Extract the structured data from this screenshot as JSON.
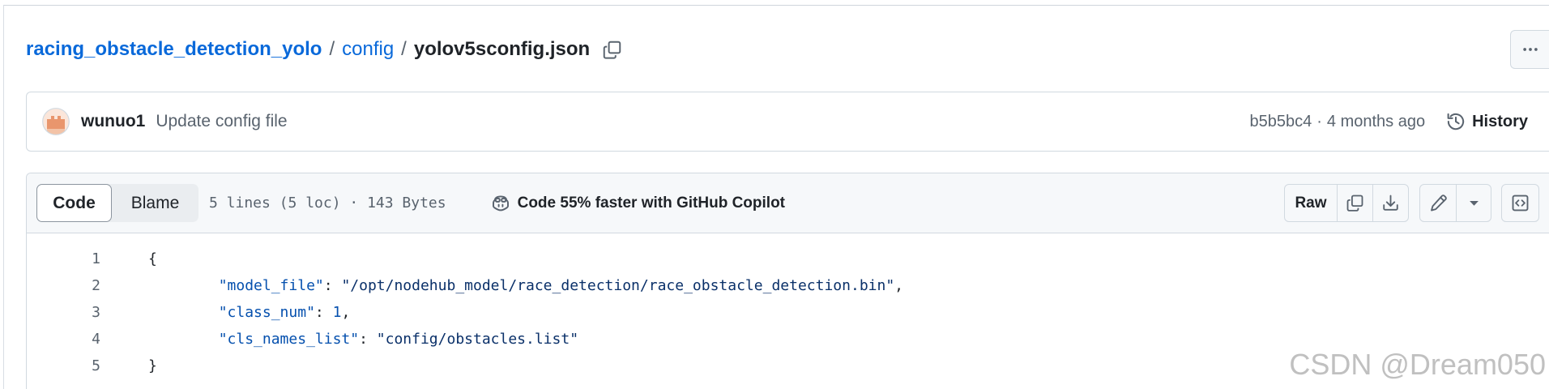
{
  "breadcrumb": {
    "repo": "racing_obstacle_detection_yolo",
    "separator": "/",
    "folder": "config",
    "file": "yolov5sconfig.json"
  },
  "commit": {
    "author": "wunuo1",
    "message": "Update config file",
    "sha": "b5b5bc4",
    "dot": "·",
    "time": "4 months ago",
    "history": "History"
  },
  "file_header": {
    "tabs": [
      {
        "label": "Code",
        "selected": true
      },
      {
        "label": "Blame",
        "selected": false
      }
    ],
    "info": "5 lines (5 loc) · 143 Bytes",
    "copilot": "Code 55% faster with GitHub Copilot",
    "raw": "Raw"
  },
  "code": {
    "lines": [
      {
        "number": "1",
        "tokens": [
          {
            "type": "punct",
            "text": "{"
          }
        ]
      },
      {
        "number": "2",
        "tokens": [
          {
            "type": "plain",
            "text": "\t"
          },
          {
            "type": "key",
            "text": "\"model_file\""
          },
          {
            "type": "punct",
            "text": ": "
          },
          {
            "type": "string",
            "text": "\"/opt/nodehub_model/race_detection/race_obstacle_detection.bin\""
          },
          {
            "type": "punct",
            "text": ","
          }
        ]
      },
      {
        "number": "3",
        "tokens": [
          {
            "type": "plain",
            "text": "\t"
          },
          {
            "type": "key",
            "text": "\"class_num\""
          },
          {
            "type": "punct",
            "text": ": "
          },
          {
            "type": "number",
            "text": "1"
          },
          {
            "type": "punct",
            "text": ","
          }
        ]
      },
      {
        "number": "4",
        "tokens": [
          {
            "type": "plain",
            "text": "\t"
          },
          {
            "type": "key",
            "text": "\"cls_names_list\""
          },
          {
            "type": "punct",
            "text": ": "
          },
          {
            "type": "string",
            "text": "\"config/obstacles.list\""
          }
        ]
      },
      {
        "number": "5",
        "tokens": [
          {
            "type": "punct",
            "text": "}"
          }
        ]
      }
    ]
  },
  "watermark": "CSDN @Dream050",
  "colors": {
    "link": "#0969da",
    "text": "#1f2328",
    "muted": "#59636e",
    "border": "#d1d9e0",
    "header_bg": "#f6f8fa",
    "json_key": "#0550ae",
    "json_string": "#0a3069",
    "json_number": "#0550ae",
    "avatar": "#e9966d"
  },
  "icons": {
    "copy_path": "copy-icon",
    "more": "kebab-horizontal-icon",
    "history": "history-icon",
    "copilot": "copilot-icon",
    "copy_raw": "copy-icon",
    "download": "download-icon",
    "edit": "pencil-icon",
    "edit_menu": "triangle-down-icon",
    "symbols": "code-square-icon"
  }
}
